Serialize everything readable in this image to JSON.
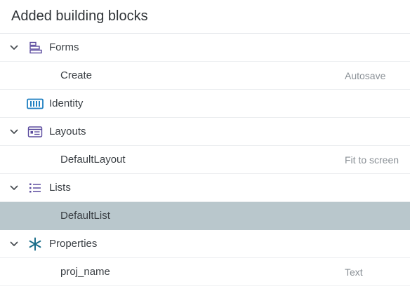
{
  "panel": {
    "title": "Added building blocks",
    "tree": {
      "forms": {
        "label": "Forms",
        "icon": "forms-icon",
        "child": {
          "label": "Create",
          "meta": "Autosave"
        }
      },
      "identity": {
        "label": "Identity",
        "icon": "identity-icon"
      },
      "layouts": {
        "label": "Layouts",
        "icon": "layouts-icon",
        "child": {
          "label": "DefaultLayout",
          "meta": "Fit to screen"
        }
      },
      "lists": {
        "label": "Lists",
        "icon": "lists-icon",
        "child": {
          "label": "DefaultList",
          "selected": true
        }
      },
      "properties": {
        "label": "Properties",
        "icon": "properties-icon",
        "child": {
          "label": "proj_name",
          "meta": "Text"
        }
      }
    }
  },
  "colors": {
    "purple_icon": "#5b4b9e",
    "blue_icon": "#1f7fc1",
    "teal_icon": "#1b6e8a",
    "selected_bg": "#b9c7cc"
  }
}
